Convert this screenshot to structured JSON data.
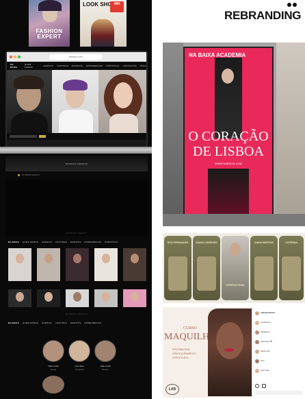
{
  "brand": {
    "rebranding": "REBRANDING"
  },
  "magazines": {
    "left_title": "FASHION EXPERT",
    "right_title": "LOOK SHOOT",
    "badge": "48H"
  },
  "website": {
    "url": "nbaixa.com",
    "nav": [
      "NA BAIXA",
      "QUEM SOMOS",
      "AGENCIA",
      "CASTINGS",
      "EVENTOS",
      "EXPERIENCIAS",
      "PORTFOLIO",
      "CONTACTOS",
      "BLOG"
    ],
    "footer_label": "NA BAIXA AGENCY",
    "strip_label": "NA BAIXA AGENCIA"
  },
  "poster": {
    "logo": "NA BAIXA ACADEMIA",
    "tagline": "O CORAÇÃO DE LISBOA",
    "line1": "O CORAÇÃO",
    "line2": "DE LISBOA",
    "url": "WWW.NABAIXA.COM"
  },
  "cards": [
    "RITA FERNANDES",
    "JOANA CORDEIRO",
    "PATRÍCIA ROSA",
    "DIANA MARTINS",
    "CATERINA"
  ],
  "course_ad": {
    "pre": "CURSO",
    "title": "MAQUILHAGEM",
    "bullets": [
      "PROFISSIONAL",
      "COM EQUIPAMENTO",
      "CERTIFICADO"
    ],
    "logo": "LAB"
  },
  "team": [
    {
      "name": "Sara Costa",
      "role": "Model"
    },
    {
      "name": "Inês Silva",
      "role": "Fotógrafa"
    },
    {
      "name": "João Costa",
      "role": "Booker"
    }
  ],
  "comments": [
    "nabaixaofficial",
    "Lindíssimo!",
    "Parabéns!",
    "Adoramos ❤",
    "Muito bom",
    "Top!",
    "Que lindo"
  ]
}
